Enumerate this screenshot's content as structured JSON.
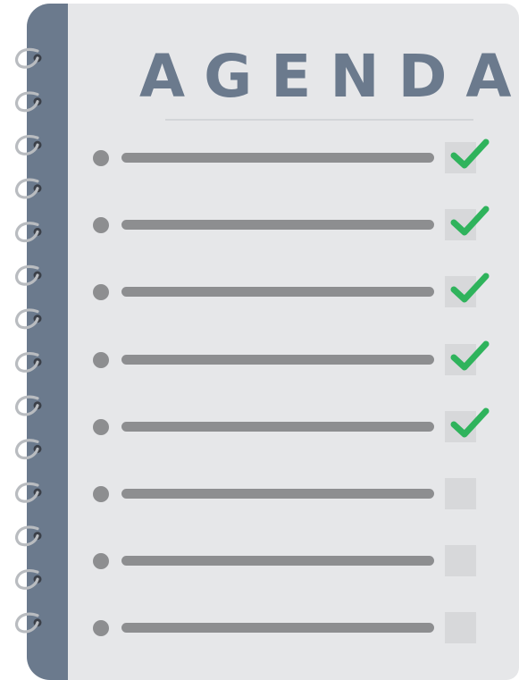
{
  "agenda": {
    "title": "AGENDA",
    "items": [
      {
        "done": true
      },
      {
        "done": true
      },
      {
        "done": true
      },
      {
        "done": true
      },
      {
        "done": true
      },
      {
        "done": false
      },
      {
        "done": false
      },
      {
        "done": false
      }
    ]
  },
  "colors": {
    "page": "#e6e7e9",
    "spine": "#6b7a8d",
    "title": "#6b7a8d",
    "bullet_line": "#8d8e90",
    "checkbox": "#d7d8da",
    "check": "#2fb35c",
    "ring": "#b9bcc0"
  },
  "icons": {
    "check": "check-icon",
    "bullet": "bullet-icon",
    "ring": "spiral-ring-icon"
  }
}
